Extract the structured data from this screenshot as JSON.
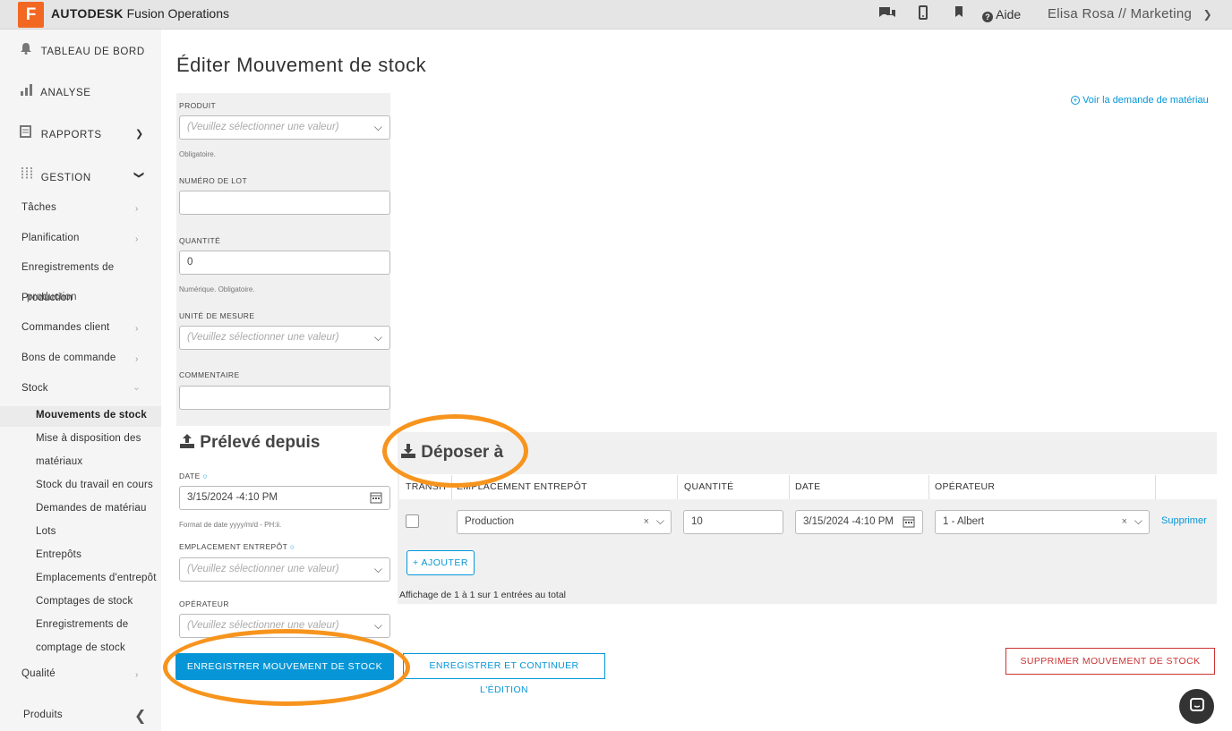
{
  "header": {
    "logo_letter": "F",
    "brand_bold": "AUTODESK",
    "brand_rest": "Fusion Operations",
    "help_label": "Aide",
    "user_label": "Elisa Rosa // Marketing"
  },
  "sidebar": {
    "tableau": "TABLEAU DE BORD",
    "analyse": "ANALYSE",
    "rapports": "RAPPORTS",
    "gestion": "GESTION",
    "items": {
      "taches": "Tâches",
      "planification": "Planification",
      "enreg_prod_1": "Enregistrements de",
      "enreg_prod_2a": "Production",
      "enreg_prod_2b": "production",
      "commandes_client": "Commandes client",
      "bons_commande": "Bons de commande",
      "stock": "Stock",
      "qualite": "Qualité",
      "produits": "Produits"
    },
    "stock_items": {
      "mouvements": "Mouvements de stock",
      "mise_dispo_1": "Mise à disposition des",
      "mise_dispo_2": "matériaux",
      "stock_travail": "Stock du travail en cours",
      "demandes": "Demandes de matériau",
      "lots": "Lots",
      "entrepots": "Entrepôts",
      "emplacements": "Emplacements d'entrepôt",
      "comptages": "Comptages de stock",
      "enreg_comptage_1": "Enregistrements de",
      "enreg_comptage_2": "comptage de stock"
    }
  },
  "page": {
    "title": "Éditer Mouvement de stock",
    "voir_link": "Voir la demande de matériau"
  },
  "form": {
    "produit_label": "PRODUIT",
    "produit_placeholder": "(Veuillez sélectionner une valeur)",
    "produit_help": "Obligatoire.",
    "lot_label": "NUMÉRO DE LOT",
    "lot_value": "",
    "quantite_label": "QUANTITÉ",
    "quantite_value": "0",
    "quantite_help": "Numérique. Obligatoire.",
    "unite_label": "UNITÉ DE MESURE",
    "unite_placeholder": "(Veuillez sélectionner une valeur)",
    "commentaire_label": "COMMENTAIRE",
    "commentaire_value": ""
  },
  "preleve": {
    "heading": "Prélevé depuis",
    "date_label": "DATE",
    "date_value": "3/15/2024 -4:10 PM",
    "date_help": "Format de date yyyy/m/d - PH:ii.",
    "emplacement_label": "EMPLACEMENT ENTREPÔT",
    "emplacement_placeholder": "(Veuillez sélectionner une valeur)",
    "operateur_label": "OPÉRATEUR",
    "operateur_placeholder": "(Veuillez sélectionner une valeur)"
  },
  "deposer": {
    "heading": "Déposer à",
    "columns": [
      "TRANSIT",
      "EMPLACEMENT ENTREPÔT",
      "QUANTITÉ",
      "DATE",
      "OPÉRATEUR"
    ],
    "row": {
      "emplacement": "Production",
      "quantite": "10",
      "date": "3/15/2024 -4:10 PM",
      "operateur": "1 - Albert",
      "supprimer": "Supprimer"
    },
    "ajouter_label": "+ AJOUTER",
    "affichage": "Affichage de 1 à 1 sur 1 entrées au total"
  },
  "actions": {
    "enregistrer": "ENREGISTRER MOUVEMENT DE STOCK",
    "enregistrer_continuer": "ENREGISTRER ET CONTINUER L'ÉDITION",
    "supprimer": "SUPPRIMER MOUVEMENT DE STOCK"
  },
  "colors": {
    "accent": "#0696d7",
    "brand_orange": "#f26822",
    "highlight_ring": "#f7941d",
    "danger": "#cc3333"
  }
}
